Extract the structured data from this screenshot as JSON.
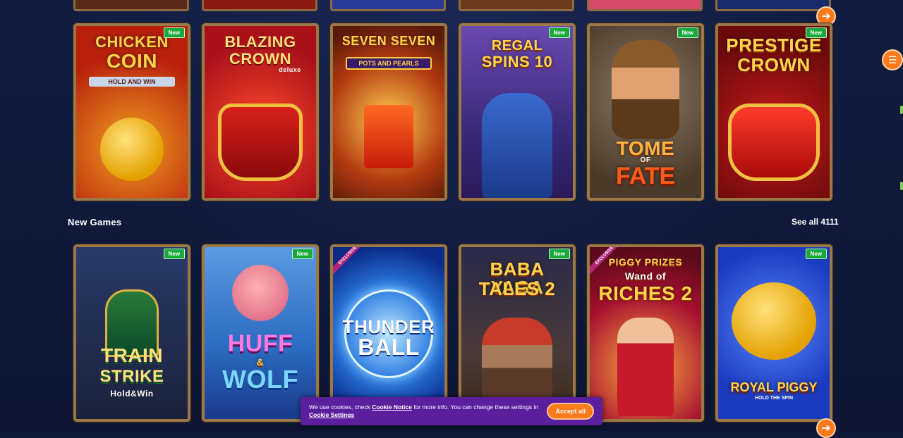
{
  "top_row": {
    "games": [
      {
        "line1": "CHICKEN",
        "line2": "COIN",
        "sub": "HOLD AND WIN",
        "new": "New",
        "bg": "#b8200c",
        "accent": "#ffcf3a"
      },
      {
        "line1": "BLAZING",
        "line2": "CROWN",
        "sub": "deluxe",
        "new": "",
        "bg": "#c0181c",
        "accent": "#ffd54a"
      },
      {
        "line1": "SEVEN SEVEN",
        "line2": "",
        "sub": "POTS AND PEARLS",
        "new": "",
        "bg": "#b33a10",
        "accent": "#ffcf3a"
      },
      {
        "line1": "REGAL",
        "line2": "SPINS 10",
        "sub": "",
        "new": "New",
        "bg": "#4a2a8a",
        "accent": "#ffd54a"
      },
      {
        "line1": "TOME",
        "line2": "FATE",
        "sub": "OF",
        "new": "New",
        "bg": "#6a4a2a",
        "accent": "#ffb340"
      },
      {
        "line1": "PRESTIGE",
        "line2": "CROWN",
        "sub": "",
        "new": "New",
        "bg": "#7a1010",
        "accent": "#ffcf3a"
      }
    ]
  },
  "new_games": {
    "title": "New Games",
    "see_all": "See all 4111",
    "games": [
      {
        "line1": "TRAIN",
        "line2": "STRIKE",
        "sub": "Hold&Win",
        "new": "New",
        "exclusive": "",
        "bg": "#1d2a4a",
        "accent": "#ffcf3a"
      },
      {
        "line1": "HUFF",
        "line2": "WOLF",
        "sub": "&",
        "new": "New",
        "exclusive": "",
        "bg": "#3a7ad0",
        "accent": "#ff6ad0"
      },
      {
        "line1": "THUNDER",
        "line2": "BALL",
        "sub": "",
        "new": "",
        "exclusive": "EXCLUSIVE",
        "bg": "#1b4fd0",
        "accent": "#e8f4ff"
      },
      {
        "line1": "BABA YAGA",
        "line2": "TALES 2",
        "sub": "",
        "new": "New",
        "exclusive": "",
        "bg": "#5a3a2a",
        "accent": "#ffcf3a"
      },
      {
        "line1": "PIGGY PRIZES",
        "line2": "RICHES 2",
        "sub": "Wand of",
        "new": "",
        "exclusive": "EXCLUSIVE",
        "bg": "#8a1024",
        "accent": "#ffcf3a"
      },
      {
        "line1": "ROYAL PIGGY",
        "line2": "",
        "sub": "HOLD THE SPIN",
        "new": "New",
        "exclusive": "",
        "bg": "#1a4ac0",
        "accent": "#ffcf3a"
      }
    ]
  },
  "cookie": {
    "text1": "We use cookies, check",
    "link1": "Cookie Notice",
    "text2": "for more info. You can change these settings in",
    "link2": "Cookie Settings",
    "accept": "Accept all"
  },
  "icons": {
    "next": "arrow-right-icon",
    "menu": "menu-icon"
  },
  "colors": {
    "accent": "#ff7a1a",
    "frame": "#9a7848",
    "background": "#10193a",
    "cookie_bg": "#5b1e9d",
    "new_badge": "#18a93a"
  }
}
